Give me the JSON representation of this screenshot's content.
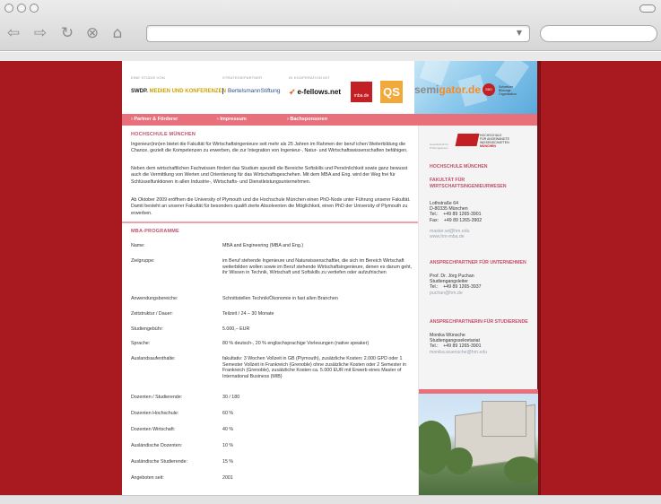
{
  "browser": {
    "back_icon": "back-arrow-icon",
    "forward_icon": "forward-arrow-icon",
    "reload_icon": "reload-icon",
    "stop_icon": "stop-icon",
    "home_icon": "home-icon",
    "url_value": "",
    "search_value": ""
  },
  "header": {
    "label_study": "EINE STUDIE VON",
    "label_partner": "STRATEGIEPARTNER",
    "label_coop": "IN KOOPERATION MIT",
    "logo_swdp_a": "SWDP.",
    "logo_swdp_b": "MEDIEN UND KONFERENZEN",
    "logo_bertelsmann": "BertelsmannStiftung",
    "logo_efellows": "e-fellows.net",
    "logo_mba": "mba.de",
    "logo_qs": "QS",
    "logo_semi_a": "semi",
    "logo_semi_b": "gator.de",
    "logo_sbo": "SBO",
    "logo_sbo_text": "Schweizer Bildungs Organisation"
  },
  "menu": {
    "items": [
      {
        "label": "› Partner & Förderer"
      },
      {
        "label": "› Impressum"
      },
      {
        "label": "› Bachsponsoren"
      }
    ]
  },
  "intro": {
    "title": "HOCHSCHULE MÜNCHEN",
    "p1": "Ingenieur(inn)en bietet die Fakultät für Wirtschaftsingenieure seit mehr als 25 Jahren im Rahmen der beruf ichen Weiterbildung die Chance, gezielt die Kompetenzen zu erwerben, die zur Integration von Ingenieur-, Natur- und Wirtschaftswissenschaften befähigen.",
    "p2": "Neben dem wirtschaftlichen Fachwissen fördert das Studium speziell die Bereiche Softskills und Persönlichkeit sowie ganz bewusst auch die Vermittlung von Werten und Orientierung für das Wirtschaftsgeschehen. Mit dem MBA and Eng. wird der Weg frei für Schlüsselfunktionen in allen Industrie-, Wirtschafts- und Dienstleistungsunternehmen.",
    "p3": "Ab Oktober 2009 eröffnen die University of Plymouth und die Hochschule München einen PhD-Node unter Führung unserer Fakultät. Damit besteht an unserer Fakultät für besonders qualifi zierte Absolventen die Möglichkeit, einen PhD der University of Plymouth zu erwerben."
  },
  "program": {
    "title": "MBA-PROGRAMME",
    "rows": [
      {
        "label": "Name:",
        "value": "MBA and Engineering (MBA and Eng.)"
      },
      {
        "label": "Zielgruppe:",
        "value": "im Beruf stehende Ingenieure und Naturwissenschaftler, die sich im Bereich Wirtschaft weiterbilden wollen sowie im Beruf stehende Wirtschaftsingenieure, denen es darum geht, ihr Wissen in Technik, Wirtschaft und Softskills zu vertiefen oder aufzufrischen"
      },
      {
        "label": "Anwendungsbereiche:",
        "value": "Schnittstellen Technik/Ökonomie in fast allen Branchen"
      },
      {
        "label": "Zeitstruktur / Dauer:",
        "value": "Teilzeit / 24 – 30 Monate"
      },
      {
        "label": "Studiengebühr:",
        "value": "5.000,– EUR"
      },
      {
        "label": "Sprache:",
        "value": "80 % deutsch-, 20 % englischsprachige Vorlesungen (native speaker)"
      },
      {
        "label": "Auslandsaufenthalte:",
        "value": "fakultativ: 3 Wochen Vollzeit in GB (Plymouth), zusätzliche Kosten: 2.000 GPD oder 1 Semester Vollzeit in Frankreich (Grenoble) ohne zusätzliche Kosten oder 2 Semester in Frankreich (Grenoble), zusätzliche Kosten ca. 5.000 EUR mit Erwerb eines Master of International Business (MIB)"
      },
      {
        "label": "Dozenten / Studierende:",
        "value": "30 / 180"
      },
      {
        "label": "Dozenten Hochschule:",
        "value": "60 %"
      },
      {
        "label": "Dozenten Wirtschaft:",
        "value": "40 %"
      },
      {
        "label": "Ausländische Dozenten:",
        "value": "10 %"
      },
      {
        "label": "Ausländische Studierende:",
        "value": "15 %"
      },
      {
        "label": "Angeboten seit:",
        "value": "2001"
      }
    ]
  },
  "sidebar": {
    "tiny_label": "Gesellschaft für Prüfungswesen",
    "logo_line1": "HOCHSCHULE",
    "logo_line2": "FÜR ANGEWANDTE",
    "logo_line3": "WISSENSCHAFTEN",
    "logo_line4": "MÜNCHEN",
    "h1": "HOCHSCHULE MÜNCHEN",
    "h2": "FAKULTÄT FÜR WIRTSCHAFTSINGENIEURWESEN",
    "address": "Lothstraße 64\nD-80335 München\nTel.:    +49 89 1265-3901\nFax:    +49 89 1265-3902",
    "email1": "master.wi@hm.edu",
    "web1": "www.hm-mba.de",
    "h3": "ANSPRECHPARTNER FÜR UNTERNEHMEN",
    "contact1": "Prof. Dr. Jörg Puchan\nStudiengangsleiter\nTel.:    +49 89 1265-3937",
    "email2": "puchan@hm.de",
    "h4": "ANSPRECHPARTNERIN FÜR STUDIERENDE",
    "contact2": "Monika Wünsche\nStudiengangssekretariat\nTel.:    +49 89 1265-3901",
    "email3": "monika.wuensche@hm.edu"
  },
  "colors": {
    "accent": "#e8707b",
    "heading": "#c0506a",
    "background": "#a81a20"
  }
}
